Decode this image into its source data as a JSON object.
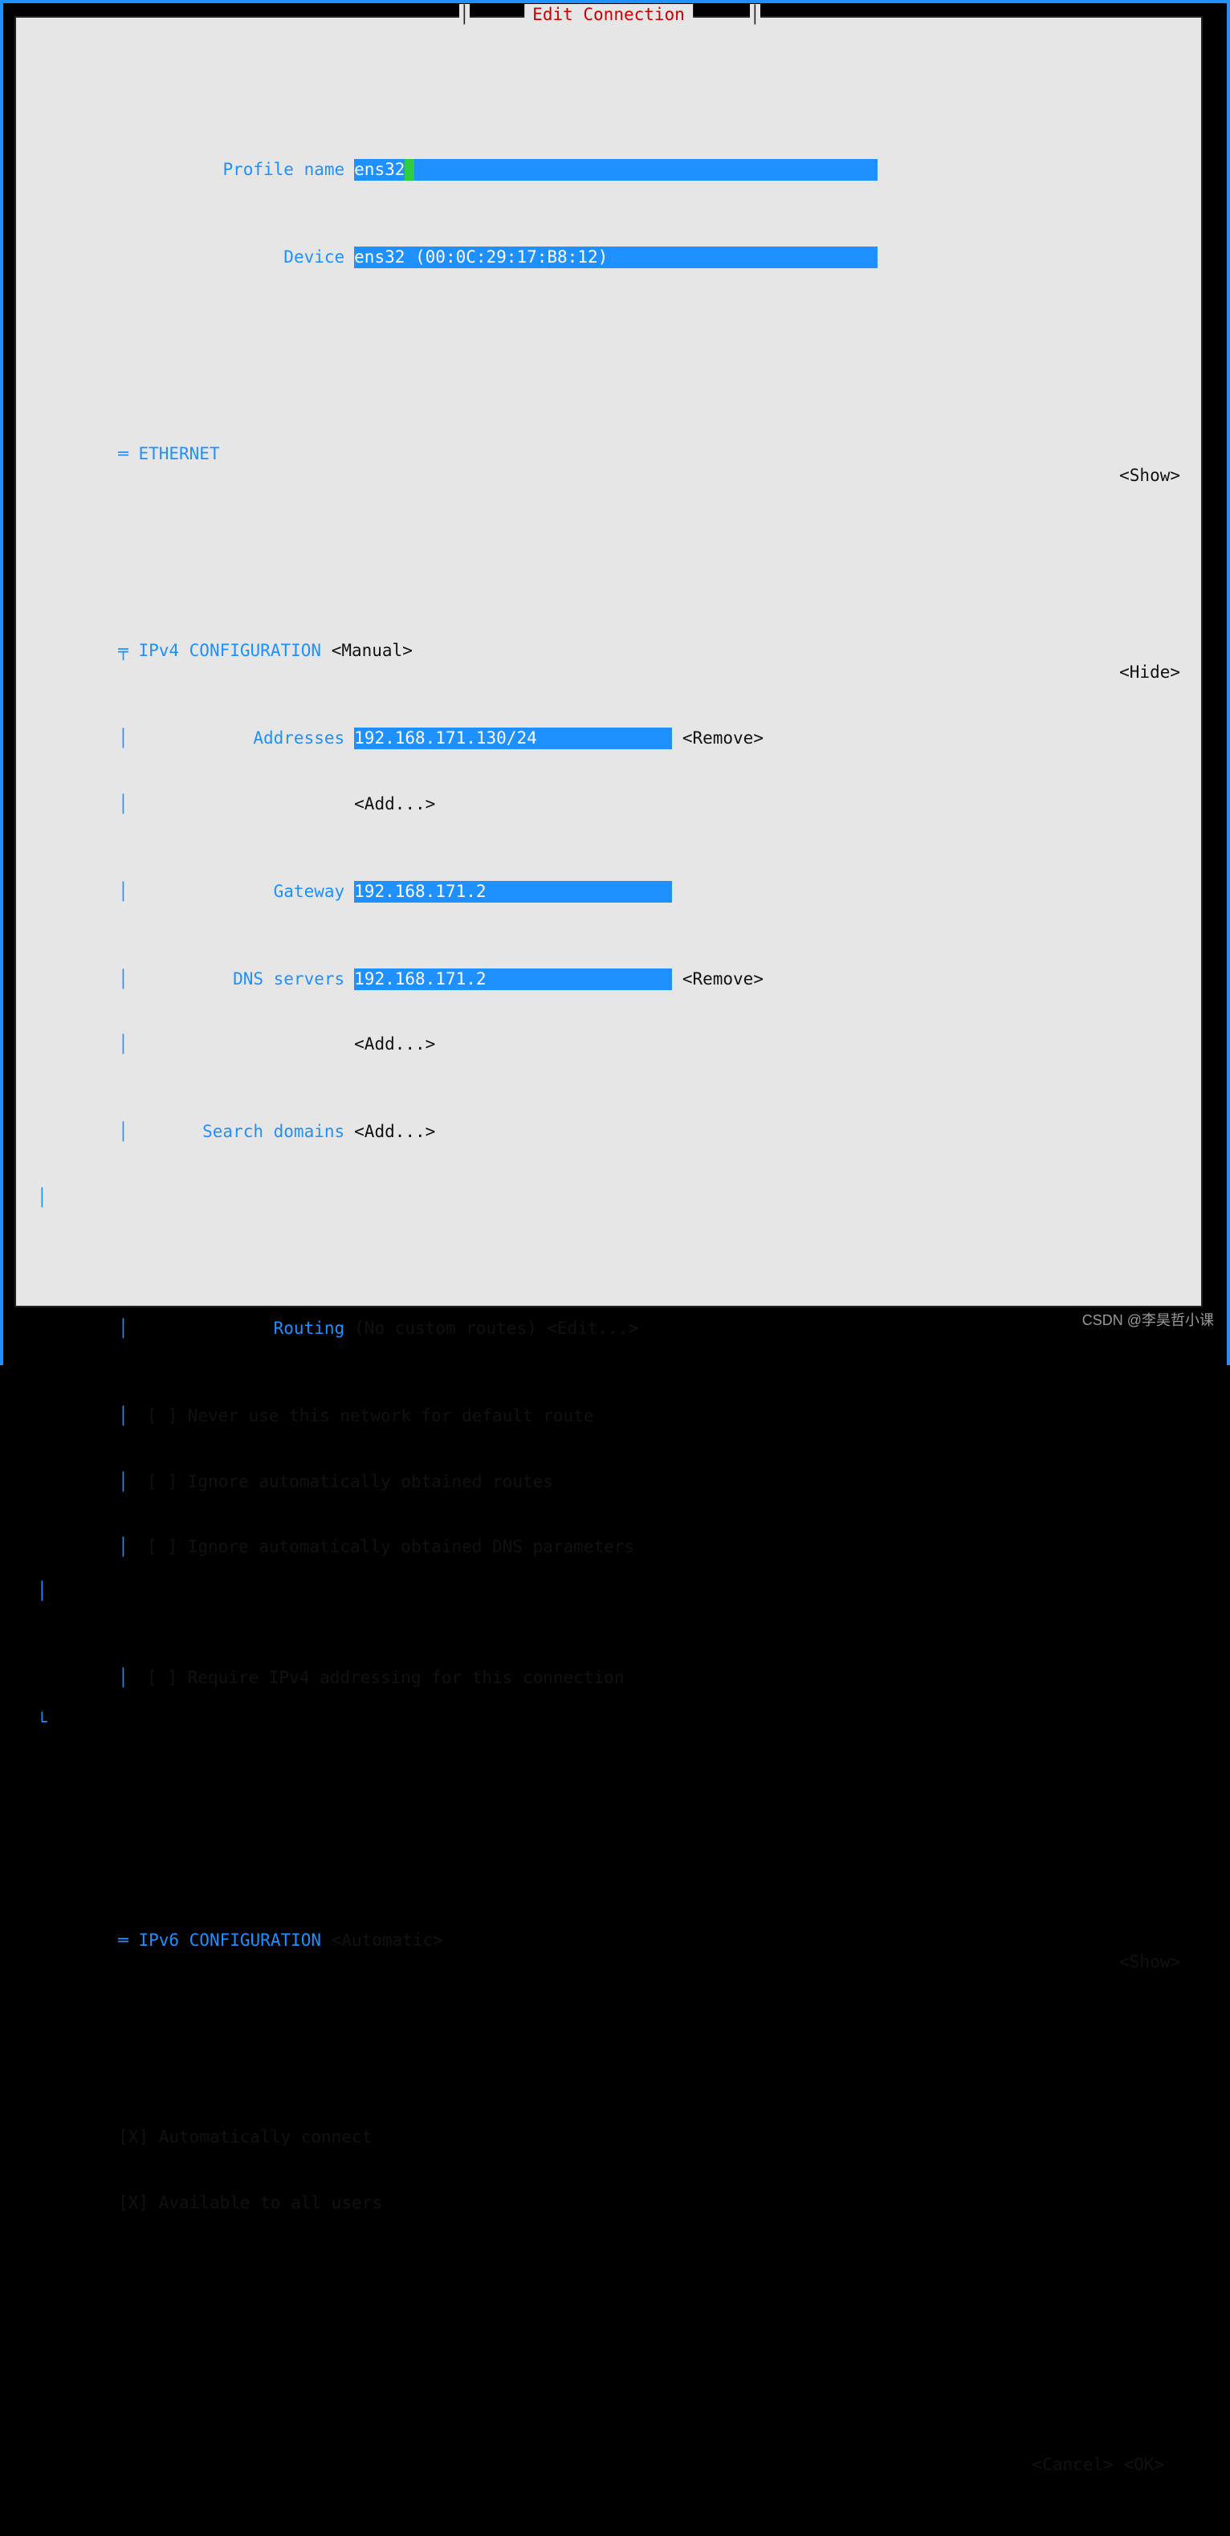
{
  "title": "Edit Connection",
  "profile_name_label": "Profile name",
  "profile_name_value": "ens32",
  "device_label": "Device",
  "device_value": "ens32 (00:0C:29:17:B8:12)",
  "ethernet": {
    "header": "ETHERNET",
    "toggle": "<Show>"
  },
  "ipv4": {
    "header": "IPv4 CONFIGURATION",
    "mode": "<Manual>",
    "toggle": "<Hide>",
    "addresses_label": "Addresses",
    "addresses_value": "192.168.171.130/24",
    "addresses_remove": "<Remove>",
    "addresses_add": "<Add...>",
    "gateway_label": "Gateway",
    "gateway_value": "192.168.171.2",
    "dns_label": "DNS servers",
    "dns_value": "192.168.171.2",
    "dns_remove": "<Remove>",
    "dns_add": "<Add...>",
    "search_label": "Search domains",
    "search_add": "<Add...>",
    "routing_label": "Routing",
    "routing_value": "(No custom routes)",
    "routing_edit": "<Edit...>",
    "cb_never_default": "Never use this network for default route",
    "cb_ignore_routes": "Ignore automatically obtained routes",
    "cb_ignore_dns": "Ignore automatically obtained DNS parameters",
    "cb_require_ipv4": "Require IPv4 addressing for this connection"
  },
  "ipv6": {
    "header": "IPv6 CONFIGURATION",
    "mode": "<Automatic>",
    "toggle": "<Show>"
  },
  "cb_autoconnect": "Automatically connect",
  "cb_all_users": "Available to all users",
  "actions": {
    "cancel": "<Cancel>",
    "ok": "<OK>"
  },
  "watermark": "CSDN @李昊哲小课",
  "glyph": {
    "sect": "═",
    "tee": "╤",
    "bar": "│",
    "corner": "└",
    "pipe": "│",
    "box_empty": "[ ]",
    "box_checked": "[X]"
  }
}
